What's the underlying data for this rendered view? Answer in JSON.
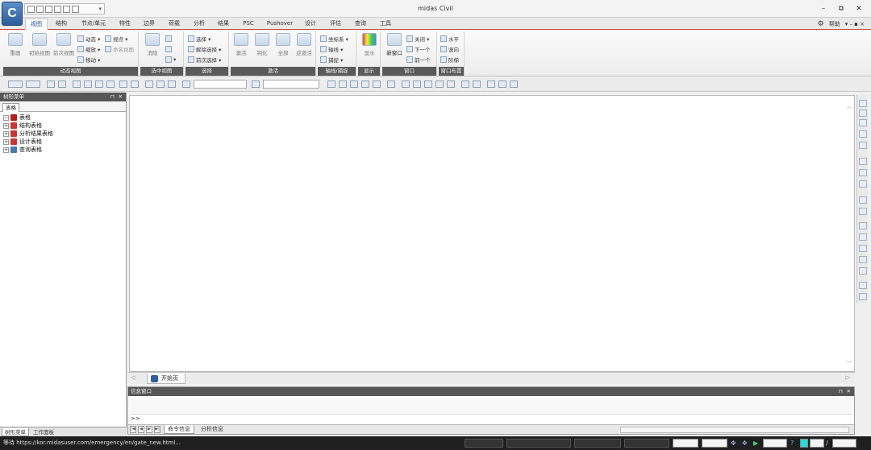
{
  "app": {
    "title": "midas Civil",
    "logo": "C",
    "window_controls": {
      "minimize": "–",
      "restore": "⧉",
      "close": "✕"
    }
  },
  "menu_tabs": [
    "视图",
    "结构",
    "节点/单元",
    "特性",
    "边界",
    "荷载",
    "分析",
    "结果",
    "PSC",
    "Pushover",
    "设计",
    "评估",
    "查询",
    "工具"
  ],
  "active_tab": "视图",
  "help": {
    "label": "帮助",
    "controls": "▾  –  ▪  ×"
  },
  "ribbon": {
    "groups": [
      {
        "label": "动态视图",
        "buttons": [
          {
            "label": "重画"
          },
          {
            "label": "初始视图"
          },
          {
            "label": "前次视图"
          }
        ],
        "small": [
          {
            "label": "动态 ▾"
          },
          {
            "label": "缩放 ▾"
          },
          {
            "label": "移动 ▾"
          },
          {
            "label": "视点 ▾"
          },
          {
            "label": "命名视图"
          }
        ]
      },
      {
        "label": "选中视图",
        "buttons": [
          {
            "label": "消隐"
          }
        ]
      },
      {
        "label": "选择",
        "small": [
          {
            "label": "选择 ▾"
          },
          {
            "label": "解除选择 ▾"
          },
          {
            "label": "前次选择 ▾"
          }
        ]
      },
      {
        "label": "激活",
        "buttons": [
          {
            "label": "激活"
          },
          {
            "label": "钝化"
          },
          {
            "label": "全部"
          },
          {
            "label": "逆激活"
          }
        ]
      },
      {
        "label": "轴线/捕捉",
        "small": [
          {
            "label": "坐标系 ▾"
          },
          {
            "label": "轴线 ▾"
          },
          {
            "label": "捕捉 ▾"
          }
        ]
      },
      {
        "label": "显示",
        "buttons": [
          {
            "label": "显示"
          }
        ]
      },
      {
        "label": "窗口",
        "buttons": [
          {
            "label": "新窗口"
          }
        ],
        "small": [
          {
            "label": "关闭 ▾"
          },
          {
            "label": "下一个"
          },
          {
            "label": "前一个"
          }
        ]
      },
      {
        "label": "窗口布置",
        "small": [
          {
            "label": "水平"
          },
          {
            "label": "竖向"
          },
          {
            "label": "阶梯"
          }
        ]
      }
    ]
  },
  "tree_panel": {
    "title": "树形菜单",
    "tab": "表格",
    "nodes": [
      {
        "label": "表格",
        "expander": "−",
        "level": 0
      },
      {
        "label": "结构表格",
        "expander": "+",
        "level": 1
      },
      {
        "label": "分析结果表格",
        "expander": "+",
        "level": 1
      },
      {
        "label": "设计表格",
        "expander": "+",
        "level": 1
      },
      {
        "label": "查询表格",
        "expander": "+",
        "level": 1
      }
    ],
    "bottom_tabs": [
      "树形菜单",
      "工作面板"
    ],
    "pin": "⊓",
    "close": "✕"
  },
  "document_tab": {
    "label": "开始页"
  },
  "message_window": {
    "title": "信息窗口",
    "prompt": ">>",
    "tabs": [
      "命令信息",
      "分析信息"
    ],
    "pin": "⊓",
    "close": "✕"
  },
  "status": {
    "text": "等待 https://kor.midasuser.com/emergency/en/gate_new.html...",
    "separator": "/"
  }
}
